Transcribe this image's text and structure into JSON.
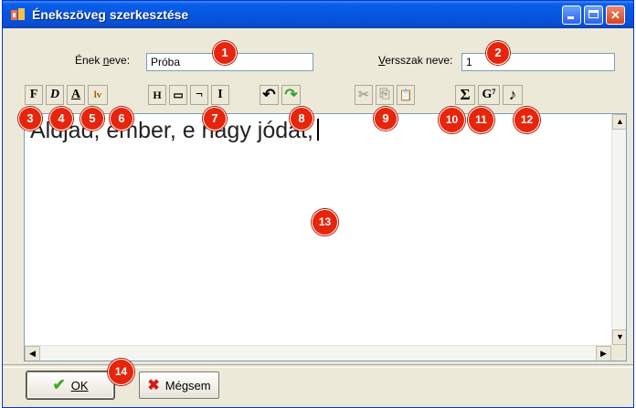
{
  "window": {
    "title": "Énekszöveg szerkesztése",
    "controls": {
      "minimize": "_",
      "maximize": "□",
      "close": "✕"
    }
  },
  "fields": {
    "song_name": {
      "label_pre": "Ének ",
      "label_underlined": "n",
      "label_post": "eve:",
      "value": "Próba"
    },
    "verse_name": {
      "label_pre": "",
      "label_underlined": "V",
      "label_post": "ersszak neve:",
      "value": "1"
    }
  },
  "toolbar": {
    "bold": "F",
    "italic": "D",
    "underline": "A",
    "spacing": "lv",
    "hyphen": "H",
    "dash": "▭",
    "break": "¬",
    "cursor": "I",
    "undo": "↶",
    "redo": "↷",
    "cut": "✂",
    "copy": "⎘",
    "paste": "📋",
    "sigma": "Σ",
    "chord": "G⁷",
    "note": "♪"
  },
  "editor": {
    "text": "Áldjad, ember, e nagy jódat,"
  },
  "buttons": {
    "ok": "OK",
    "cancel": "Mégsem"
  },
  "callouts": [
    "1",
    "2",
    "3",
    "4",
    "5",
    "6",
    "7",
    "8",
    "9",
    "10",
    "11",
    "12",
    "13",
    "14"
  ],
  "colors": {
    "title_bar": "#0554e0",
    "callout": "#e7250c",
    "ok_icon": "#4aa82a",
    "cancel_icon": "#d81a12"
  },
  "icons": {
    "ok": "check-icon",
    "cancel": "x-icon",
    "app": "song-edit-icon"
  }
}
